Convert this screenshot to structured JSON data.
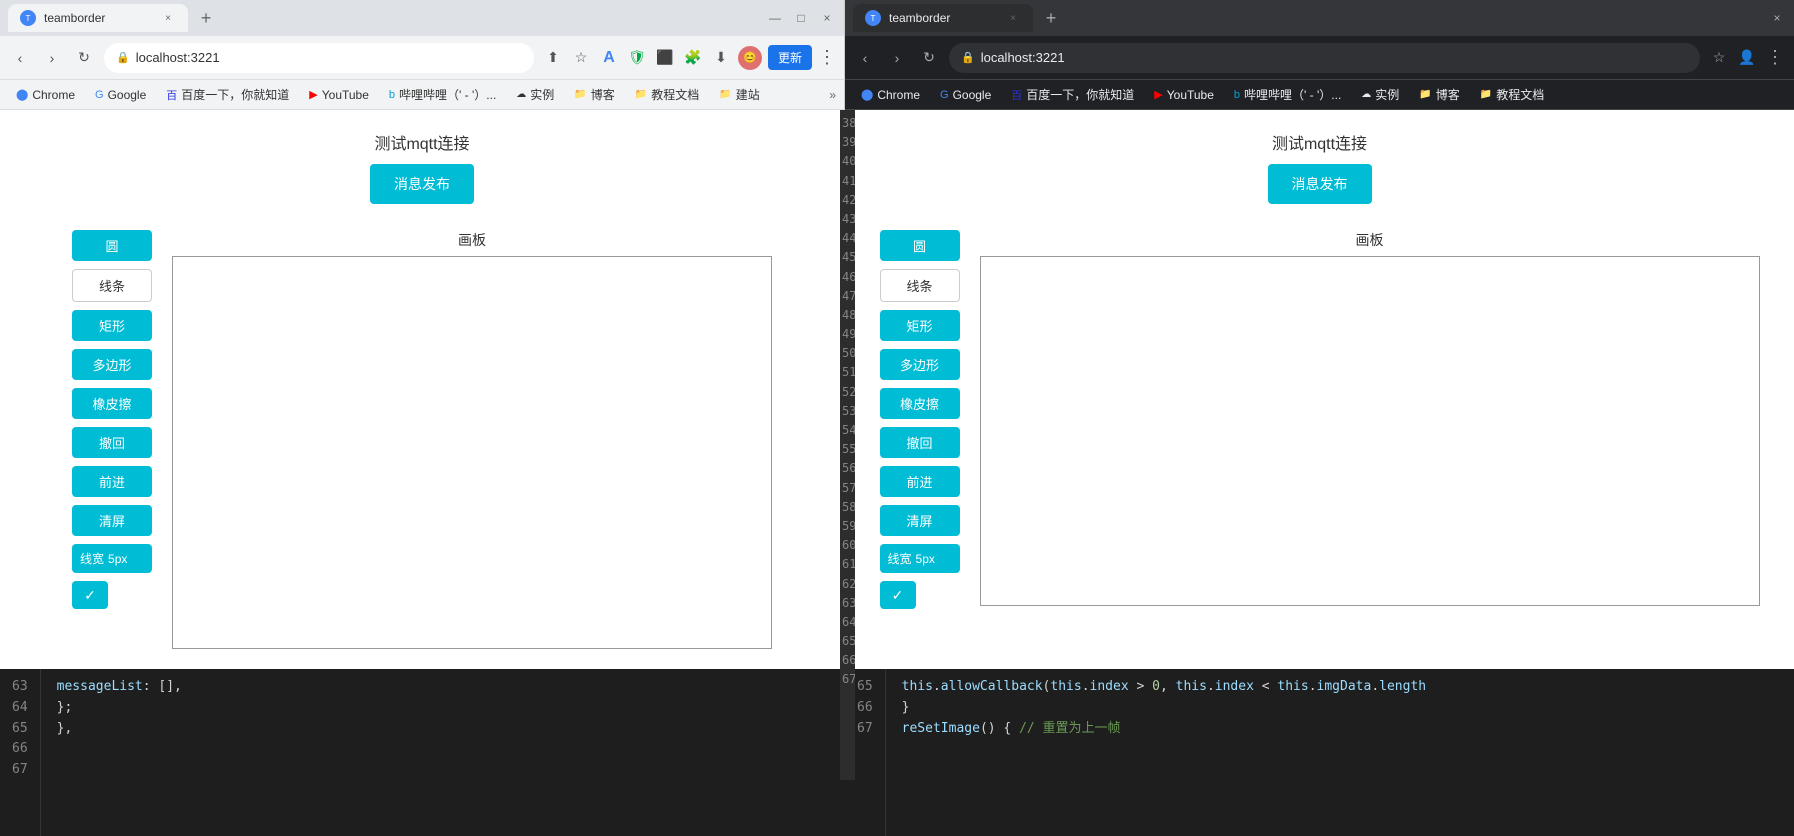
{
  "leftBrowser": {
    "tab": {
      "title": "teamborder",
      "favicon": "T",
      "closeLabel": "×",
      "newTabLabel": "+"
    },
    "winControls": [
      "—",
      "□",
      "×"
    ],
    "address": {
      "url": "localhost:3221",
      "lock": "🔒"
    },
    "bookmarks": [
      {
        "label": "Chrome",
        "icon": "C"
      },
      {
        "label": "Google",
        "icon": "G"
      },
      {
        "label": "百度一下，你就知道",
        "icon": "B"
      },
      {
        "label": "YouTube",
        "icon": "▶"
      },
      {
        "label": "哔哩哔哩（' - '）...",
        "icon": "b"
      },
      {
        "label": "实例",
        "icon": "⬜"
      },
      {
        "label": "博客",
        "icon": "📁"
      },
      {
        "label": "教程文档",
        "icon": "📁"
      },
      {
        "label": "建站",
        "icon": "📁"
      }
    ],
    "page": {
      "title": "测试mqtt连接",
      "publishBtn": "消息发布",
      "canvasLabel": "画板",
      "tools": [
        {
          "label": "圆",
          "style": "filled"
        },
        {
          "label": "线条",
          "style": "outline"
        },
        {
          "label": "矩形",
          "style": "filled"
        },
        {
          "label": "多边形",
          "style": "filled"
        },
        {
          "label": "橡皮擦",
          "style": "filled"
        },
        {
          "label": "撤回",
          "style": "filled"
        },
        {
          "label": "前进",
          "style": "filled"
        },
        {
          "label": "清屏",
          "style": "filled"
        }
      ],
      "lineWidthLabel": "线宽",
      "lineWidthValue": "5px",
      "colorBtnCheck": "✓"
    }
  },
  "rightBrowser": {
    "tab": {
      "title": "teamborder",
      "favicon": "T",
      "closeLabel": "×",
      "newTabLabel": "+"
    },
    "winControls": [
      "×"
    ],
    "address": {
      "url": "localhost:3221",
      "lock": "🔒"
    },
    "bookmarks": [
      {
        "label": "Chrome",
        "icon": "C"
      },
      {
        "label": "Google",
        "icon": "G"
      },
      {
        "label": "百度一下，你就知道",
        "icon": "B"
      },
      {
        "label": "YouTube",
        "icon": "▶"
      },
      {
        "label": "哔哩哔哩（' - '）...",
        "icon": "b"
      },
      {
        "label": "实例",
        "icon": "⬜"
      },
      {
        "label": "博客",
        "icon": "📁"
      },
      {
        "label": "教程文档",
        "icon": "📁"
      }
    ],
    "page": {
      "title": "测试mqtt连接",
      "publishBtn": "消息发布",
      "canvasLabel": "画板",
      "tools": [
        {
          "label": "圆",
          "style": "filled"
        },
        {
          "label": "线条",
          "style": "outline"
        },
        {
          "label": "矩形",
          "style": "filled"
        },
        {
          "label": "多边形",
          "style": "filled"
        },
        {
          "label": "橡皮擦",
          "style": "filled"
        },
        {
          "label": "撤回",
          "style": "filled"
        },
        {
          "label": "前进",
          "style": "filled"
        },
        {
          "label": "清屏",
          "style": "filled"
        }
      ],
      "lineWidthLabel": "线宽",
      "lineWidthValue": "5px",
      "colorBtnCheck": "✓"
    }
  },
  "leftCode": {
    "lines": [
      "63",
      "64",
      "65",
      "66",
      "67"
    ],
    "content": [
      "    messageList: [],",
      "  };",
      "},",
      ""
    ]
  },
  "rightCode": {
    "lines": [
      "65",
      "66",
      "67"
    ],
    "content": [
      "    this.allowCallback(this.index > 0, this.index < this.imgData.length",
      "  }",
      "  reSetImage() { // 重置为上一帧"
    ]
  },
  "colors": {
    "teal": "#00bcd4",
    "darkBg": "#202124",
    "codeBg": "#1e1e1e"
  }
}
